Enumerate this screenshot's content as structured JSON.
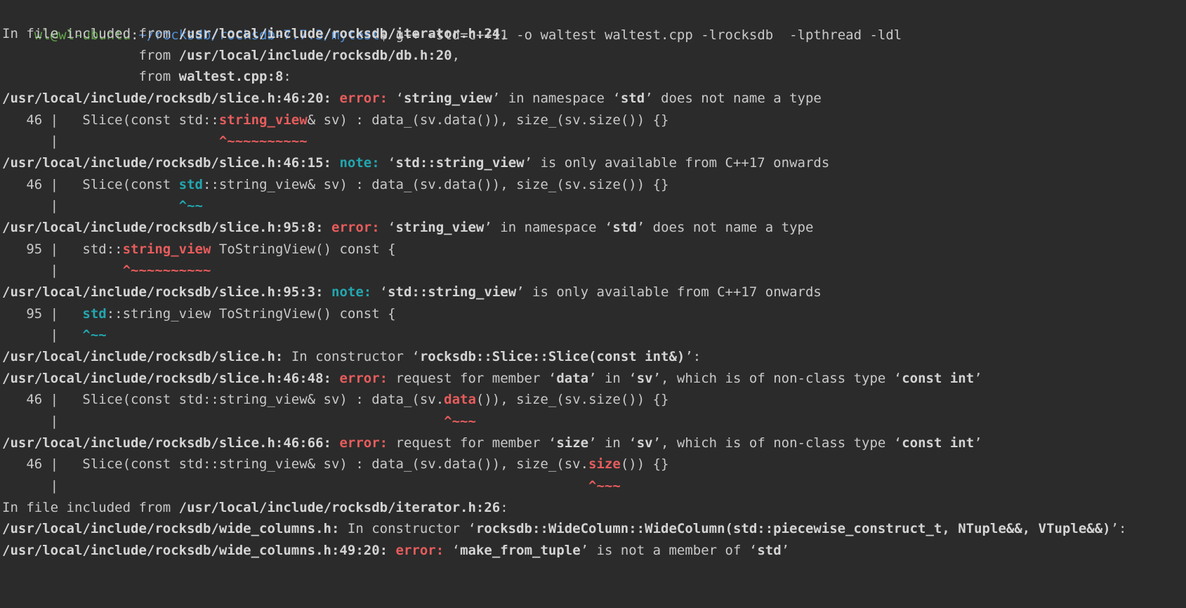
{
  "prompt": {
    "user_host": "wl@wl-ubuntu",
    "sep": ":",
    "path": "~/rocksdb/rocksdb-7.7.3/mytest",
    "dollar": "$ ",
    "command": "g++ -std=c++11 -o waltest waltest.cpp -lrocksdb  -lpthread -ldl"
  },
  "output": [
    [
      {
        "t": "In file included from "
      },
      {
        "t": "/usr/local/include/rocksdb/iterator.h:24",
        "s": "b"
      },
      {
        "t": ","
      }
    ],
    [
      {
        "t": "                 from "
      },
      {
        "t": "/usr/local/include/rocksdb/db.h:20",
        "s": "b"
      },
      {
        "t": ","
      }
    ],
    [
      {
        "t": "                 from "
      },
      {
        "t": "waltest.cpp:8",
        "s": "b"
      },
      {
        "t": ":"
      }
    ],
    [
      {
        "t": "/usr/local/include/rocksdb/slice.h:46:20:",
        "s": "b"
      },
      {
        "t": " "
      },
      {
        "t": "error:",
        "s": "redb"
      },
      {
        "t": " ‘"
      },
      {
        "t": "string_view",
        "s": "b"
      },
      {
        "t": "’ in namespace ‘"
      },
      {
        "t": "std",
        "s": "b"
      },
      {
        "t": "’ does not name a type"
      }
    ],
    [
      {
        "t": "   46 |   Slice(const std::"
      },
      {
        "t": "string_view",
        "s": "redb"
      },
      {
        "t": "& sv) : data_(sv.data()), size_(sv.size()) {}"
      }
    ],
    [
      {
        "t": "      |                    "
      },
      {
        "t": "^~~~~~~~~~~",
        "s": "redb"
      }
    ],
    [
      {
        "t": "/usr/local/include/rocksdb/slice.h:46:15:",
        "s": "b"
      },
      {
        "t": " "
      },
      {
        "t": "note:",
        "s": "tealb"
      },
      {
        "t": " ‘"
      },
      {
        "t": "std::string_view",
        "s": "b"
      },
      {
        "t": "’ is only available from C++17 onwards"
      }
    ],
    [
      {
        "t": "   46 |   Slice(const "
      },
      {
        "t": "std",
        "s": "tealb"
      },
      {
        "t": "::string_view& sv) : data_(sv.data()), size_(sv.size()) {}"
      }
    ],
    [
      {
        "t": "      |               "
      },
      {
        "t": "^~~",
        "s": "tealb"
      }
    ],
    [
      {
        "t": "/usr/local/include/rocksdb/slice.h:95:8:",
        "s": "b"
      },
      {
        "t": " "
      },
      {
        "t": "error:",
        "s": "redb"
      },
      {
        "t": " ‘"
      },
      {
        "t": "string_view",
        "s": "b"
      },
      {
        "t": "’ in namespace ‘"
      },
      {
        "t": "std",
        "s": "b"
      },
      {
        "t": "’ does not name a type"
      }
    ],
    [
      {
        "t": "   95 |   std::"
      },
      {
        "t": "string_view",
        "s": "redb"
      },
      {
        "t": " ToStringView() const {"
      }
    ],
    [
      {
        "t": "      |        "
      },
      {
        "t": "^~~~~~~~~~~",
        "s": "redb"
      }
    ],
    [
      {
        "t": "/usr/local/include/rocksdb/slice.h:95:3:",
        "s": "b"
      },
      {
        "t": " "
      },
      {
        "t": "note:",
        "s": "tealb"
      },
      {
        "t": " ‘"
      },
      {
        "t": "std::string_view",
        "s": "b"
      },
      {
        "t": "’ is only available from C++17 onwards"
      }
    ],
    [
      {
        "t": "   95 |   "
      },
      {
        "t": "std",
        "s": "tealb"
      },
      {
        "t": "::string_view ToStringView() const {"
      }
    ],
    [
      {
        "t": "      |   "
      },
      {
        "t": "^~~",
        "s": "tealb"
      }
    ],
    [
      {
        "t": "/usr/local/include/rocksdb/slice.h:",
        "s": "b"
      },
      {
        "t": " In constructor ‘"
      },
      {
        "t": "rocksdb::Slice::Slice(const int&)",
        "s": "b"
      },
      {
        "t": "’:"
      }
    ],
    [
      {
        "t": "/usr/local/include/rocksdb/slice.h:46:48:",
        "s": "b"
      },
      {
        "t": " "
      },
      {
        "t": "error:",
        "s": "redb"
      },
      {
        "t": " request for member ‘"
      },
      {
        "t": "data",
        "s": "b"
      },
      {
        "t": "’ in ‘"
      },
      {
        "t": "sv",
        "s": "b"
      },
      {
        "t": "’, which is of non-class type ‘"
      },
      {
        "t": "const int",
        "s": "b"
      },
      {
        "t": "’"
      }
    ],
    [
      {
        "t": "   46 |   Slice(const std::string_view& sv) : data_(sv."
      },
      {
        "t": "data",
        "s": "redb"
      },
      {
        "t": "()), size_(sv.size()) {}"
      }
    ],
    [
      {
        "t": "      |                                                "
      },
      {
        "t": "^~~~",
        "s": "redb"
      }
    ],
    [
      {
        "t": "/usr/local/include/rocksdb/slice.h:46:66:",
        "s": "b"
      },
      {
        "t": " "
      },
      {
        "t": "error:",
        "s": "redb"
      },
      {
        "t": " request for member ‘"
      },
      {
        "t": "size",
        "s": "b"
      },
      {
        "t": "’ in ‘"
      },
      {
        "t": "sv",
        "s": "b"
      },
      {
        "t": "’, which is of non-class type ‘"
      },
      {
        "t": "const int",
        "s": "b"
      },
      {
        "t": "’"
      }
    ],
    [
      {
        "t": "   46 |   Slice(const std::string_view& sv) : data_(sv.data()), size_(sv."
      },
      {
        "t": "size",
        "s": "redb"
      },
      {
        "t": "()) {}"
      }
    ],
    [
      {
        "t": "      |                                                                  "
      },
      {
        "t": "^~~~",
        "s": "redb"
      }
    ],
    [
      {
        "t": "In file included from "
      },
      {
        "t": "/usr/local/include/rocksdb/iterator.h:26",
        "s": "b"
      },
      {
        "t": ":"
      }
    ],
    [
      {
        "t": "/usr/local/include/rocksdb/wide_columns.h:",
        "s": "b"
      },
      {
        "t": " In constructor ‘"
      },
      {
        "t": "rocksdb::WideColumn::WideColumn(std::piecewise_construct_t, NTuple&&, VTuple&&)",
        "s": "b"
      },
      {
        "t": "’:"
      }
    ],
    [
      {
        "t": "/usr/local/include/rocksdb/wide_columns.h:49:20:",
        "s": "b"
      },
      {
        "t": " "
      },
      {
        "t": "error:",
        "s": "redb"
      },
      {
        "t": " ‘"
      },
      {
        "t": "make_from_tuple",
        "s": "b"
      },
      {
        "t": "’ is not a member of ‘"
      },
      {
        "t": "std",
        "s": "b"
      },
      {
        "t": "’"
      }
    ]
  ]
}
